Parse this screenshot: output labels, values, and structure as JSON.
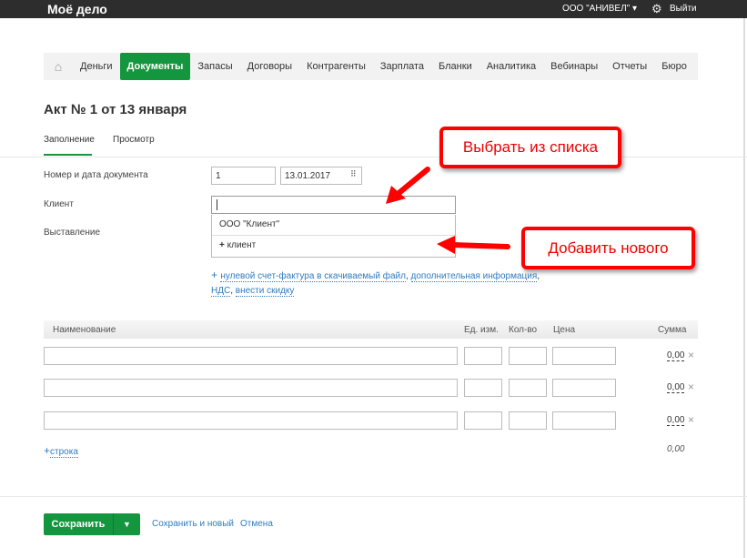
{
  "topbar": {
    "logo": "Моё дело",
    "org": "ООО \"АНИВЕЛ\" ▾",
    "logout": "Выйти"
  },
  "nav": [
    "Деньги",
    "Документы",
    "Запасы",
    "Договоры",
    "Контрагенты",
    "Зарплата",
    "Бланки",
    "Аналитика",
    "Вебинары",
    "Отчеты",
    "Бюро"
  ],
  "page": {
    "title": "Акт № 1 от 13 января",
    "tabs": [
      "Заполнение",
      "Просмотр"
    ]
  },
  "form": {
    "number_label": "Номер и дата документа",
    "number": "1",
    "date": "13.01.2017",
    "client_label": "Клиент",
    "client_value": "",
    "billing_label": "Выставление",
    "dropdown": [
      "ООО \"Клиент\"",
      "клиент"
    ],
    "links": [
      "нулевой счет-фактура в скачиваемый файл",
      "дополнительная информация",
      "НДС",
      "внести скидку"
    ]
  },
  "table": {
    "headers": [
      "Наименование",
      "Ед. изм.",
      "Кол-во",
      "Цена",
      "Сумма"
    ],
    "rows": [
      {
        "sum": "0,00"
      },
      {
        "sum": "0,00"
      },
      {
        "sum": "0,00"
      }
    ],
    "add_row": "строка",
    "total": "0,00"
  },
  "footer": {
    "save": "Сохранить",
    "save_new": "Сохранить и новый",
    "cancel": "Отмена"
  },
  "callouts": {
    "pick": "Выбрать из списка",
    "add": "Добавить нового"
  }
}
